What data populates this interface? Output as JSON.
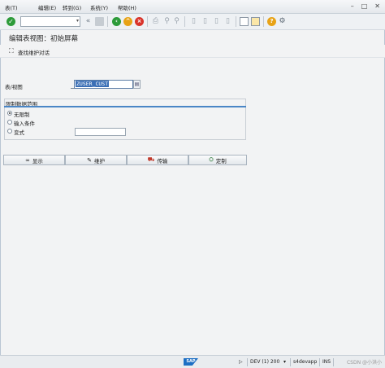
{
  "menu": {
    "items": [
      "表(T)",
      "编辑(E)",
      "转到(G)",
      "系统(Y)",
      "帮助(H)"
    ],
    "window_controls": [
      "–",
      "□",
      "✕"
    ]
  },
  "toolbar": {
    "command_value": "",
    "icons": [
      "checkmark-icon",
      "dropdown-icon",
      "double-chevron-left-icon",
      "save-icon",
      "back-icon",
      "exit-icon",
      "cancel-icon",
      "print-icon",
      "find-icon",
      "find-next-icon",
      "first-page-icon",
      "prev-page-icon",
      "next-page-icon",
      "last-page-icon",
      "new-session-icon",
      "shortcut-icon",
      "help-icon",
      "settings-icon"
    ],
    "accent_colors": {
      "ok": "#2d9b3a",
      "back": "#2d9b3a",
      "exit": "#e8a317",
      "cancel": "#d9342b",
      "help": "#e8a317"
    }
  },
  "page": {
    "title": "编辑表视图：初始屏幕",
    "app_toolbar_label": "查找维护对话"
  },
  "form": {
    "table_label": "表/视图",
    "table_value": "ZUSER_CUST",
    "group_title": "限制数据范围",
    "options": [
      {
        "label": "无限制",
        "selected": true
      },
      {
        "label": "输入条件",
        "selected": false
      },
      {
        "label": "变式",
        "selected": false
      }
    ],
    "variant_value": ""
  },
  "buttons": [
    {
      "label": "显示",
      "icon": "glasses-icon"
    },
    {
      "label": "维护",
      "icon": "pencil-icon"
    },
    {
      "label": "传输",
      "icon": "transport-icon"
    },
    {
      "label": "定制",
      "icon": "customize-icon"
    }
  ],
  "status": {
    "logo": "SAP",
    "system": "DEV (1) 200",
    "server": "s4devapp",
    "mode": "INS",
    "watermark": "CSDN @小洪小"
  }
}
